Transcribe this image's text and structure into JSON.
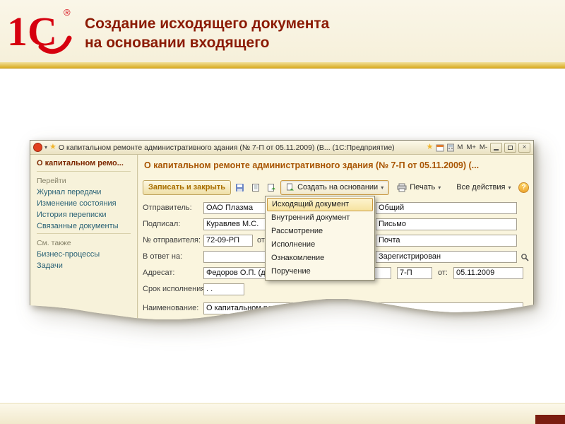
{
  "slide": {
    "logo_text": "1С",
    "logo_reg": "®",
    "title_line1": "Создание исходящего документа",
    "title_line2": "на основании входящего"
  },
  "icons": {
    "dropdown_arrow": "▾",
    "star": "★",
    "close": "×",
    "help": "?"
  },
  "window": {
    "titlebar": {
      "title": "О капитальном ремонте административного здания (№ 7-П от 05.11.2009) (В...",
      "app": "(1С:Предприятие)",
      "mem1": "М",
      "mem2": "М+",
      "mem3": "М-"
    },
    "sidebar": {
      "title": "О капитальном ремо...",
      "nav_header": "Перейти",
      "nav_links": [
        "Журнал передачи",
        "Изменение состояния",
        "История переписки",
        "Связанные документы"
      ],
      "see_also_header": "См. также",
      "see_also_links": [
        "Бизнес-процессы",
        "Задачи"
      ]
    },
    "main": {
      "heading": "О капитальном ремонте административного здания (№ 7-П от 05.11.2009) (...",
      "toolbar": {
        "save_close": "Записать и закрыть",
        "create_based": "Создать на основании",
        "print": "Печать",
        "all_actions": "Все действия"
      },
      "menu_items": [
        "Исходящий документ",
        "Внутренний документ",
        "Рассмотрение",
        "Исполнение",
        "Ознакомление",
        "Поручение"
      ],
      "fields": {
        "sender_label": "Отправитель:",
        "sender_value": "ОАО Плазма",
        "signed_label": "Подписал:",
        "signed_value": "Куравлев М.С.",
        "number_label": "№ отправителя:",
        "number_value": "72-09-РП",
        "number_from_label": "от",
        "reply_label": "В ответ на:",
        "reply_value": "",
        "addressee_label": "Адресат:",
        "addressee_value": "Федоров О.П. (директ",
        "reg_number_value": "7-П",
        "reg_date_label": "от:",
        "reg_date_value": "05.11.2009",
        "due_label": "Срок исполнения:",
        "due_value": ". .",
        "name_label": "Наименование:",
        "name_value": "О капитальном ремонте административного здания",
        "right_values": [
          "Общий",
          "Письмо",
          "Почта",
          "Зарегистрирован"
        ]
      }
    }
  }
}
